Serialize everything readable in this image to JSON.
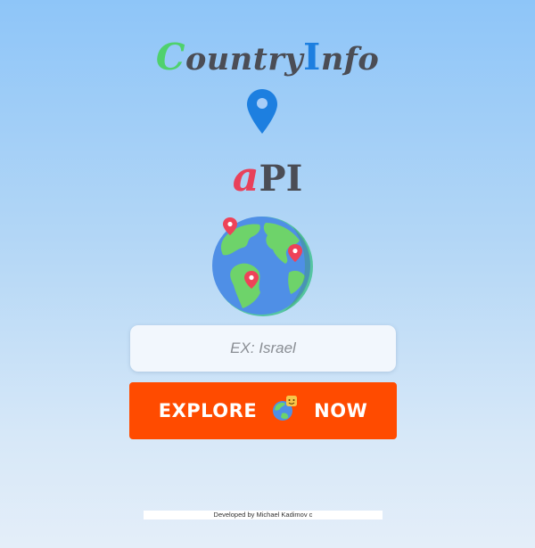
{
  "logo": {
    "first_letter": "C",
    "middle": "ountry",
    "i_letter": "I",
    "end": "nfo"
  },
  "api": {
    "a_letter": "a",
    "rest": "PI"
  },
  "search": {
    "placeholder": "EX: Israel",
    "value": ""
  },
  "explore_button": {
    "left_label": "EXPLORE",
    "right_label": "NOW"
  },
  "footer": {
    "text": "Developed by Michael Kadimov c"
  },
  "colors": {
    "brand_green": "#4fd16d",
    "brand_blue": "#1d7fe0",
    "api_red": "#e8415b",
    "button_orange": "#ff4b00",
    "text_dark": "#4b4d55"
  },
  "icons": {
    "location": "map-pin-icon",
    "globe": "globe-with-pins-icon",
    "button_globe": "smiling-globe-icon"
  }
}
